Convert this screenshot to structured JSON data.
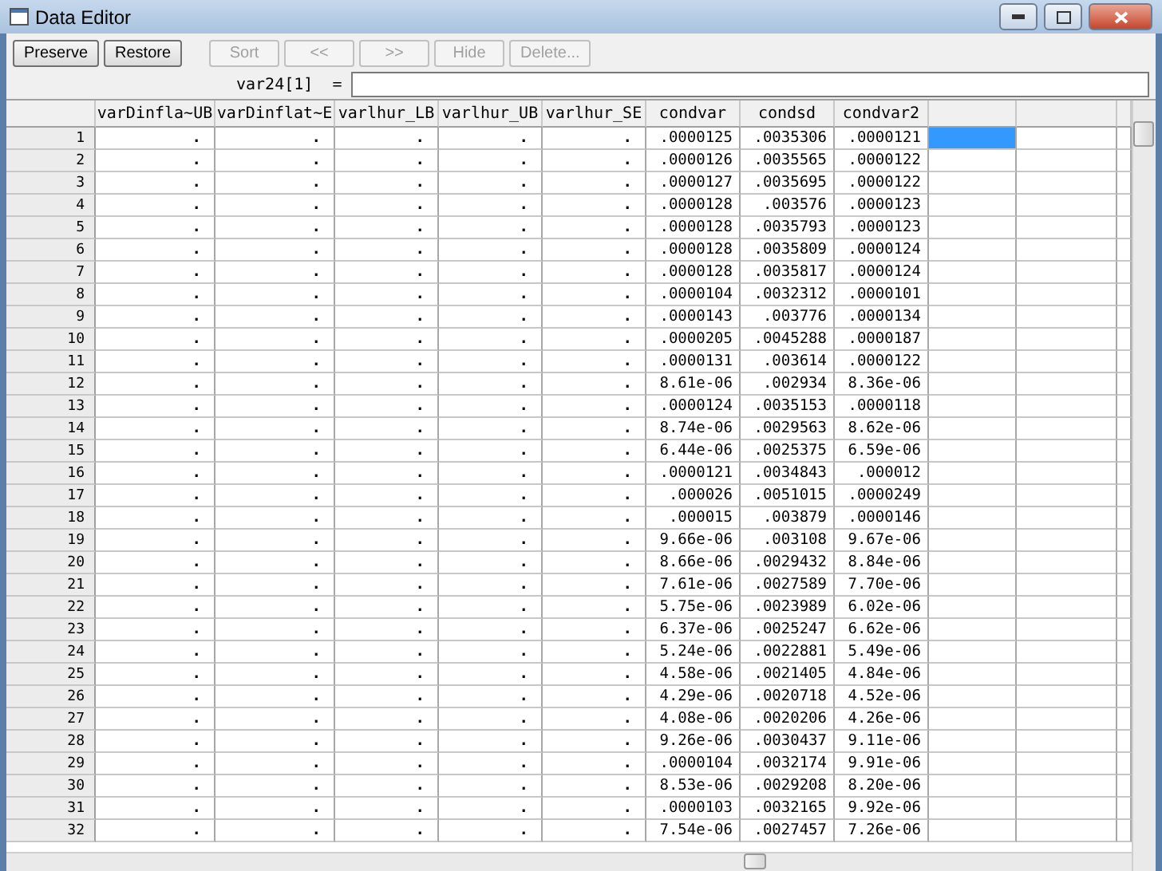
{
  "window": {
    "title": "Data Editor"
  },
  "toolbar": [
    {
      "label": "Preserve",
      "disabled": false
    },
    {
      "label": "Restore",
      "disabled": false
    },
    {
      "label": "Sort",
      "disabled": true
    },
    {
      "label": "<<",
      "disabled": true
    },
    {
      "label": ">>",
      "disabled": true
    },
    {
      "label": "Hide",
      "disabled": true
    },
    {
      "label": "Delete...",
      "disabled": true
    }
  ],
  "formula_bar": {
    "label": "var24[1]  ="
  },
  "table": {
    "columns": [
      "varDinfla~UB",
      "varDinflat~E",
      "varlhur_LB",
      "varlhur_UB",
      "varlhur_SE",
      "condvar",
      "condsd",
      "condvar2"
    ],
    "rows": [
      {
        "number": "1",
        "selected": true,
        "cells": [
          ".",
          ".",
          ".",
          ".",
          ".",
          ".0000125",
          ".0035306",
          ".0000121"
        ]
      },
      {
        "number": "2",
        "selected": false,
        "cells": [
          ".",
          ".",
          ".",
          ".",
          ".",
          ".0000126",
          ".0035565",
          ".0000122"
        ]
      },
      {
        "number": "3",
        "selected": false,
        "cells": [
          ".",
          ".",
          ".",
          ".",
          ".",
          ".0000127",
          ".0035695",
          ".0000122"
        ]
      },
      {
        "number": "4",
        "selected": false,
        "cells": [
          ".",
          ".",
          ".",
          ".",
          ".",
          ".0000128",
          ".003576",
          ".0000123"
        ]
      },
      {
        "number": "5",
        "selected": false,
        "cells": [
          ".",
          ".",
          ".",
          ".",
          ".",
          ".0000128",
          ".0035793",
          ".0000123"
        ]
      },
      {
        "number": "6",
        "selected": false,
        "cells": [
          ".",
          ".",
          ".",
          ".",
          ".",
          ".0000128",
          ".0035809",
          ".0000124"
        ]
      },
      {
        "number": "7",
        "selected": false,
        "cells": [
          ".",
          ".",
          ".",
          ".",
          ".",
          ".0000128",
          ".0035817",
          ".0000124"
        ]
      },
      {
        "number": "8",
        "selected": false,
        "cells": [
          ".",
          ".",
          ".",
          ".",
          ".",
          ".0000104",
          ".0032312",
          ".0000101"
        ]
      },
      {
        "number": "9",
        "selected": false,
        "cells": [
          ".",
          ".",
          ".",
          ".",
          ".",
          ".0000143",
          ".003776",
          ".0000134"
        ]
      },
      {
        "number": "10",
        "selected": false,
        "cells": [
          ".",
          ".",
          ".",
          ".",
          ".",
          ".0000205",
          ".0045288",
          ".0000187"
        ]
      },
      {
        "number": "11",
        "selected": false,
        "cells": [
          ".",
          ".",
          ".",
          ".",
          ".",
          ".0000131",
          ".003614",
          ".0000122"
        ]
      },
      {
        "number": "12",
        "selected": false,
        "cells": [
          ".",
          ".",
          ".",
          ".",
          ".",
          "8.61e-06",
          ".002934",
          "8.36e-06"
        ]
      },
      {
        "number": "13",
        "selected": false,
        "cells": [
          ".",
          ".",
          ".",
          ".",
          ".",
          ".0000124",
          ".0035153",
          ".0000118"
        ]
      },
      {
        "number": "14",
        "selected": false,
        "cells": [
          ".",
          ".",
          ".",
          ".",
          ".",
          "8.74e-06",
          ".0029563",
          "8.62e-06"
        ]
      },
      {
        "number": "15",
        "selected": false,
        "cells": [
          ".",
          ".",
          ".",
          ".",
          ".",
          "6.44e-06",
          ".0025375",
          "6.59e-06"
        ]
      },
      {
        "number": "16",
        "selected": false,
        "cells": [
          ".",
          ".",
          ".",
          ".",
          ".",
          ".0000121",
          ".0034843",
          ".000012"
        ]
      },
      {
        "number": "17",
        "selected": false,
        "cells": [
          ".",
          ".",
          ".",
          ".",
          ".",
          ".000026",
          ".0051015",
          ".0000249"
        ]
      },
      {
        "number": "18",
        "selected": false,
        "cells": [
          ".",
          ".",
          ".",
          ".",
          ".",
          ".000015",
          ".003879",
          ".0000146"
        ]
      },
      {
        "number": "19",
        "selected": false,
        "cells": [
          ".",
          ".",
          ".",
          ".",
          ".",
          "9.66e-06",
          ".003108",
          "9.67e-06"
        ]
      },
      {
        "number": "20",
        "selected": false,
        "cells": [
          ".",
          ".",
          ".",
          ".",
          ".",
          "8.66e-06",
          ".0029432",
          "8.84e-06"
        ]
      },
      {
        "number": "21",
        "selected": false,
        "cells": [
          ".",
          ".",
          ".",
          ".",
          ".",
          "7.61e-06",
          ".0027589",
          "7.70e-06"
        ]
      },
      {
        "number": "22",
        "selected": false,
        "cells": [
          ".",
          ".",
          ".",
          ".",
          ".",
          "5.75e-06",
          ".0023989",
          "6.02e-06"
        ]
      },
      {
        "number": "23",
        "selected": false,
        "cells": [
          ".",
          ".",
          ".",
          ".",
          ".",
          "6.37e-06",
          ".0025247",
          "6.62e-06"
        ]
      },
      {
        "number": "24",
        "selected": false,
        "cells": [
          ".",
          ".",
          ".",
          ".",
          ".",
          "5.24e-06",
          ".0022881",
          "5.49e-06"
        ]
      },
      {
        "number": "25",
        "selected": false,
        "cells": [
          ".",
          ".",
          ".",
          ".",
          ".",
          "4.58e-06",
          ".0021405",
          "4.84e-06"
        ]
      },
      {
        "number": "26",
        "selected": false,
        "cells": [
          ".",
          ".",
          ".",
          ".",
          ".",
          "4.29e-06",
          ".0020718",
          "4.52e-06"
        ]
      },
      {
        "number": "27",
        "selected": false,
        "cells": [
          ".",
          ".",
          ".",
          ".",
          ".",
          "4.08e-06",
          ".0020206",
          "4.26e-06"
        ]
      },
      {
        "number": "28",
        "selected": false,
        "cells": [
          ".",
          ".",
          ".",
          ".",
          ".",
          "9.26e-06",
          ".0030437",
          "9.11e-06"
        ]
      },
      {
        "number": "29",
        "selected": false,
        "cells": [
          ".",
          ".",
          ".",
          ".",
          ".",
          ".0000104",
          ".0032174",
          "9.91e-06"
        ]
      },
      {
        "number": "30",
        "selected": false,
        "cells": [
          ".",
          ".",
          ".",
          ".",
          ".",
          "8.53e-06",
          ".0029208",
          "8.20e-06"
        ]
      },
      {
        "number": "31",
        "selected": false,
        "cells": [
          ".",
          ".",
          ".",
          ".",
          ".",
          ".0000103",
          ".0032165",
          "9.92e-06"
        ]
      },
      {
        "number": "32",
        "selected": false,
        "cells": [
          ".",
          ".",
          ".",
          ".",
          ".",
          "7.54e-06",
          ".0027457",
          "7.26e-06"
        ]
      }
    ]
  }
}
